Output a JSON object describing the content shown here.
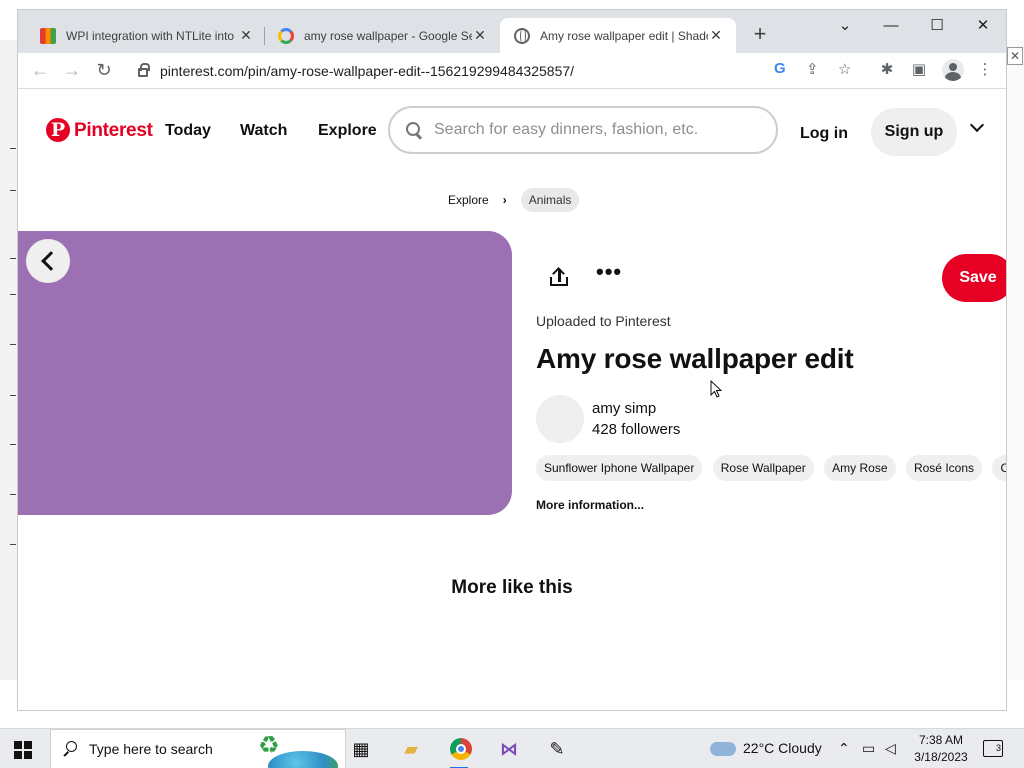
{
  "browser": {
    "tabs": [
      {
        "title": "WPI integration with NTLite into",
        "favicon": "wpi-icon",
        "active": false
      },
      {
        "title": "amy rose wallpaper - Google Sea",
        "favicon": "google-icon",
        "active": false
      },
      {
        "title": "Amy rose wallpaper edit | Shado",
        "favicon": "globe-icon",
        "active": true
      }
    ],
    "url": "pinterest.com/pin/amy-rose-wallpaper-edit--156219299484325857/"
  },
  "pinterest": {
    "brand": "Pinterest",
    "brand_color": "#e60023",
    "nav": {
      "today": "Today",
      "watch": "Watch",
      "explore": "Explore"
    },
    "search_placeholder": "Search for easy dinners, fashion, etc.",
    "login": "Log in",
    "signup": "Sign up",
    "breadcrumb": {
      "root": "Explore",
      "current": "Animals"
    },
    "pin": {
      "image_color": "#9c71b4",
      "uploaded": "Uploaded to Pinterest",
      "title": "Amy rose wallpaper edit",
      "save": "Save",
      "user_name": "amy simp",
      "followers": "428 followers",
      "tags": [
        "Sunflower Iphone Wallpaper",
        "Rose Wallpaper",
        "Amy Rose",
        "Rosé Icons",
        "Cute Ic"
      ],
      "more_info": "More information..."
    },
    "more_like_this": "More like this"
  },
  "taskbar": {
    "search_placeholder": "Type here to search",
    "weather": "22°C  Cloudy",
    "time": "7:38 AM",
    "date": "3/18/2023",
    "notifications": "3"
  }
}
